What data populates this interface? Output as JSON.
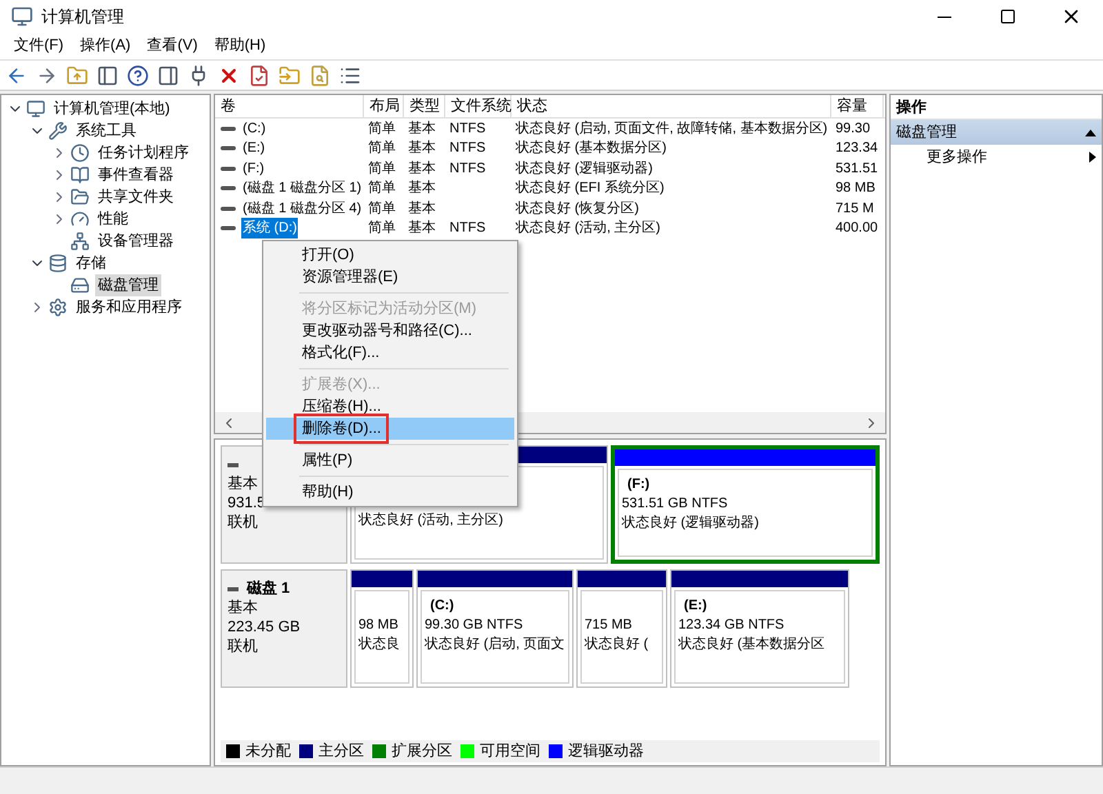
{
  "window": {
    "title": "计算机管理"
  },
  "menu_bar": [
    "文件(F)",
    "操作(A)",
    "查看(V)",
    "帮助(H)"
  ],
  "tree": [
    {
      "label": "计算机管理(本地)",
      "expanded": true,
      "selected": false,
      "children": [
        {
          "label": "系统工具",
          "expanded": true,
          "selected": false,
          "children": [
            {
              "label": "任务计划程序",
              "expanded": false,
              "selected": false
            },
            {
              "label": "事件查看器",
              "expanded": false,
              "selected": false
            },
            {
              "label": "共享文件夹",
              "expanded": false,
              "selected": false
            },
            {
              "label": "性能",
              "expanded": false,
              "selected": false
            },
            {
              "label": "设备管理器",
              "selected": false
            }
          ]
        },
        {
          "label": "存储",
          "expanded": true,
          "selected": false,
          "children": [
            {
              "label": "磁盘管理",
              "selected": true
            }
          ]
        },
        {
          "label": "服务和应用程序",
          "expanded": false,
          "selected": false
        }
      ]
    }
  ],
  "table": {
    "columns": [
      "卷",
      "布局",
      "类型",
      "文件系统",
      "状态",
      "容量"
    ],
    "rows": [
      {
        "volume": "(C:)",
        "layout": "简单",
        "type": "基本",
        "fs": "NTFS",
        "status": "状态良好 (启动, 页面文件, 故障转储, 基本数据分区)",
        "capacity": "99.30",
        "selected": false
      },
      {
        "volume": "(E:)",
        "layout": "简单",
        "type": "基本",
        "fs": "NTFS",
        "status": "状态良好 (基本数据分区)",
        "capacity": "123.34",
        "selected": false
      },
      {
        "volume": "(F:)",
        "layout": "简单",
        "type": "基本",
        "fs": "NTFS",
        "status": "状态良好 (逻辑驱动器)",
        "capacity": "531.51",
        "selected": false
      },
      {
        "volume": "(磁盘 1 磁盘分区 1)",
        "layout": "简单",
        "type": "基本",
        "status": "状态良好 (EFI 系统分区)",
        "capacity": "98 MB",
        "selected": false
      },
      {
        "volume": "(磁盘 1 磁盘分区 4)",
        "layout": "简单",
        "type": "基本",
        "status": "状态良好 (恢复分区)",
        "capacity": "715 M",
        "selected": false
      },
      {
        "volume": "系统 (D:)",
        "layout": "简单",
        "type": "基本",
        "fs": "NTFS",
        "status": "状态良好 (活动, 主分区)",
        "capacity": "400.00",
        "selected": true
      }
    ]
  },
  "disks": [
    {
      "info": [
        "基本",
        "931.5",
        "联机"
      ],
      "partitions": [
        {
          "kind": "primary",
          "extended": false,
          "lines": [
            "状态良好 (活动, 主分区)"
          ]
        },
        {
          "kind": "logical",
          "extended": true,
          "name": "(F:)",
          "lines": [
            "531.51 GB NTFS",
            "状态良好 (逻辑驱动器)"
          ]
        }
      ]
    },
    {
      "name": "磁盘 1",
      "info": [
        "基本",
        "223.45 GB",
        "联机"
      ],
      "partitions": [
        {
          "kind": "primary",
          "lines": [
            "98 MB",
            "状态良"
          ]
        },
        {
          "kind": "primary",
          "name": "(C:)",
          "lines": [
            "99.30 GB NTFS",
            "状态良好 (启动, 页面文"
          ]
        },
        {
          "kind": "primary",
          "lines": [
            "715 MB",
            "状态良好 ("
          ]
        },
        {
          "kind": "primary",
          "name": "(E:)",
          "lines": [
            "123.34 GB NTFS",
            "状态良好 (基本数据分区"
          ]
        }
      ]
    }
  ],
  "legend": [
    {
      "label": "未分配",
      "color": "#000000"
    },
    {
      "label": "主分区",
      "color": "#00007f"
    },
    {
      "label": "扩展分区",
      "color": "#007f00"
    },
    {
      "label": "可用空间",
      "color": "#00ff00"
    },
    {
      "label": "逻辑驱动器",
      "color": "#0000ff"
    }
  ],
  "context_menu": [
    {
      "kind": "item",
      "label": "打开(O)",
      "disabled": false,
      "selected": false
    },
    {
      "kind": "item",
      "label": "资源管理器(E)",
      "disabled": false,
      "selected": false
    },
    {
      "kind": "separator"
    },
    {
      "kind": "item",
      "label": "将分区标记为活动分区(M)",
      "disabled": true,
      "selected": false
    },
    {
      "kind": "item",
      "label": "更改驱动器号和路径(C)...",
      "disabled": false,
      "selected": false
    },
    {
      "kind": "item",
      "label": "格式化(F)...",
      "disabled": false,
      "selected": false
    },
    {
      "kind": "separator"
    },
    {
      "kind": "item",
      "label": "扩展卷(X)...",
      "disabled": true,
      "selected": false
    },
    {
      "kind": "item",
      "label": "压缩卷(H)...",
      "disabled": false,
      "selected": false
    },
    {
      "kind": "item",
      "label": "删除卷(D)...",
      "disabled": false,
      "selected": true,
      "outlined": true
    },
    {
      "kind": "separator"
    },
    {
      "kind": "item",
      "label": "属性(P)",
      "disabled": false,
      "selected": false
    },
    {
      "kind": "separator"
    },
    {
      "kind": "item",
      "label": "帮助(H)",
      "disabled": false,
      "selected": false
    }
  ],
  "actions": {
    "title": "操作",
    "section": {
      "label": "磁盘管理",
      "expanded": true
    },
    "items": [
      "更多操作"
    ]
  }
}
